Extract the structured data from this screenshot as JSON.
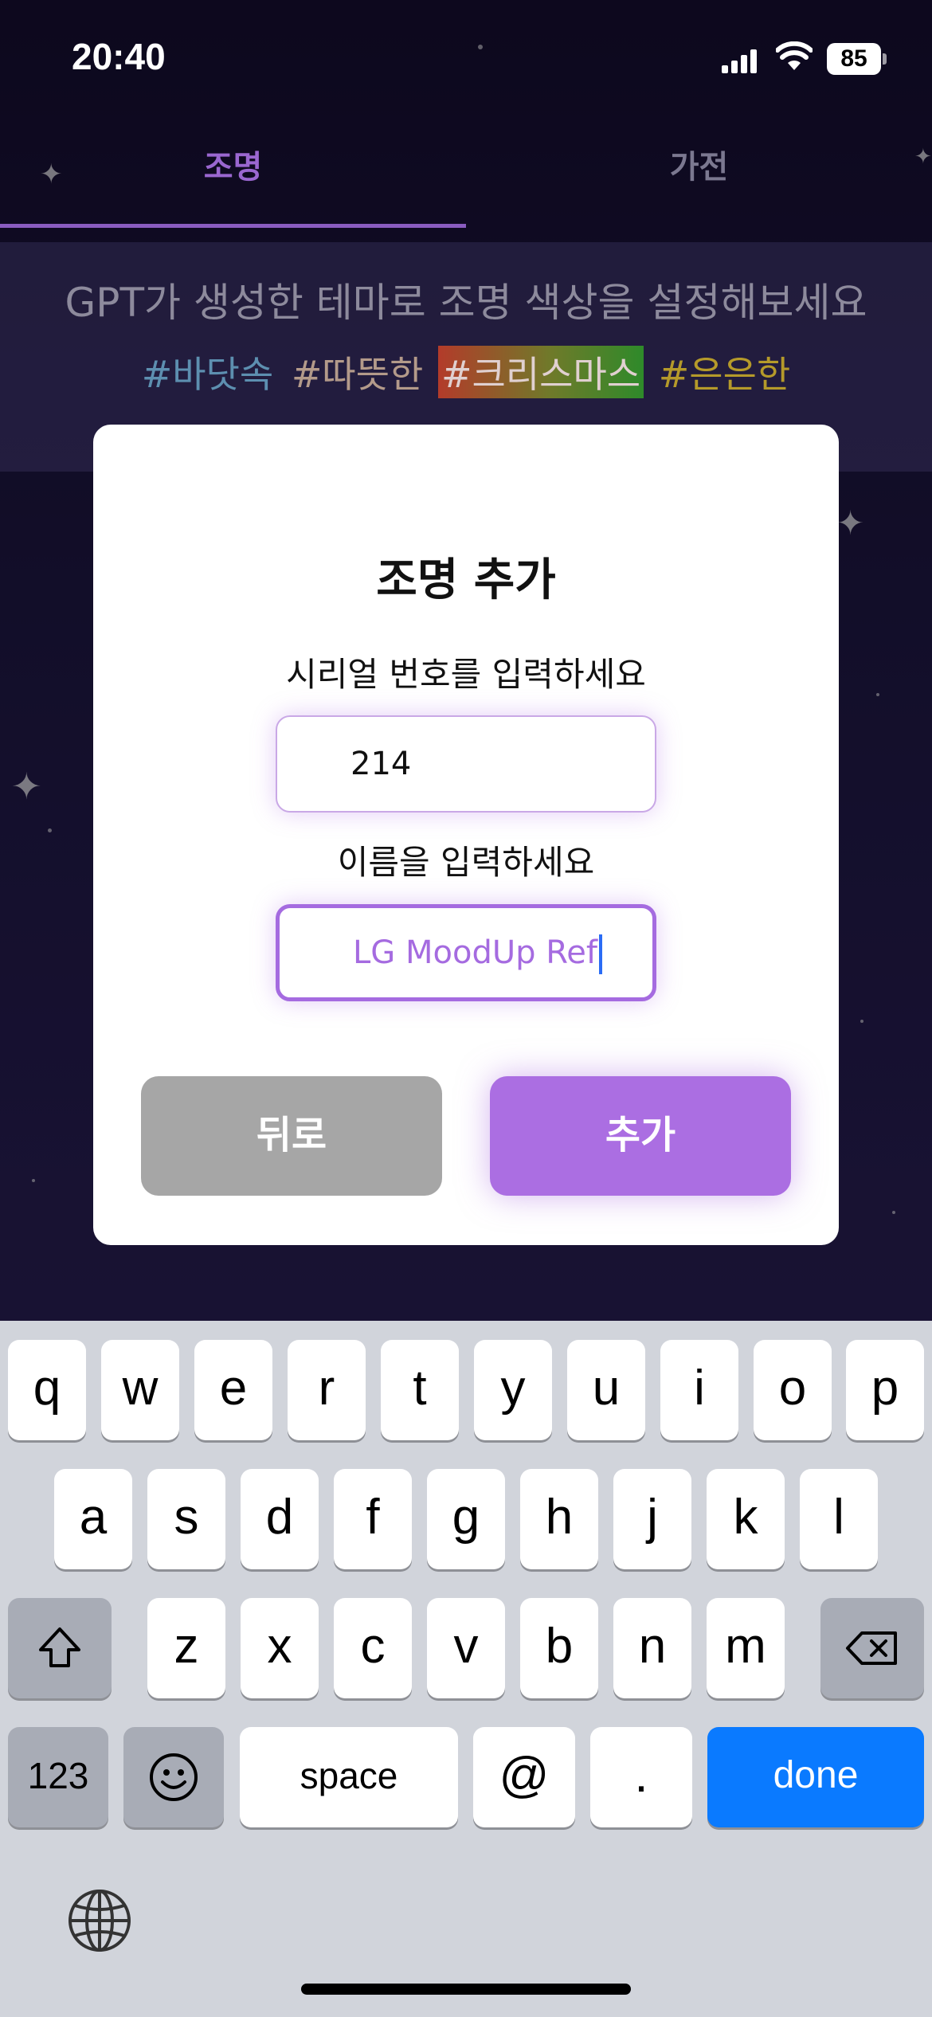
{
  "status_bar": {
    "time": "20:40",
    "battery": "85"
  },
  "tabs": [
    {
      "label": "조명",
      "active": true
    },
    {
      "label": "가전",
      "active": false
    }
  ],
  "theme_banner": {
    "title": "GPT가 생성한 테마로 조명 색상을 설정해보세요",
    "tags": [
      "#바닷속",
      "#따뜻한",
      "#크리스마스",
      "#은은한"
    ]
  },
  "dialog": {
    "title": "조명 추가",
    "serial_label": "시리얼 번호를 입력하세요",
    "serial_value": "214",
    "name_label": "이름을 입력하세요",
    "name_value": "LG MoodUp Ref",
    "back_button": "뒤로",
    "add_button": "추가"
  },
  "keyboard": {
    "row1": [
      "q",
      "w",
      "e",
      "r",
      "t",
      "y",
      "u",
      "i",
      "o",
      "p"
    ],
    "row2": [
      "a",
      "s",
      "d",
      "f",
      "g",
      "h",
      "j",
      "k",
      "l"
    ],
    "row3": [
      "z",
      "x",
      "c",
      "v",
      "b",
      "n",
      "m"
    ],
    "numbers_key": "123",
    "space_key": "space",
    "at_key": "@",
    "period_key": ".",
    "done_key": "done",
    "icons": {
      "shift": "shift-icon",
      "delete": "backspace-icon",
      "emoji": "emoji-icon",
      "globe": "globe-icon"
    }
  },
  "colors": {
    "accent": "#ab6ee2",
    "back_button": "#a6a6a6",
    "done_key": "#0a7aff",
    "keyboard_bg": "#d1d4db",
    "background": "#1d1640"
  }
}
